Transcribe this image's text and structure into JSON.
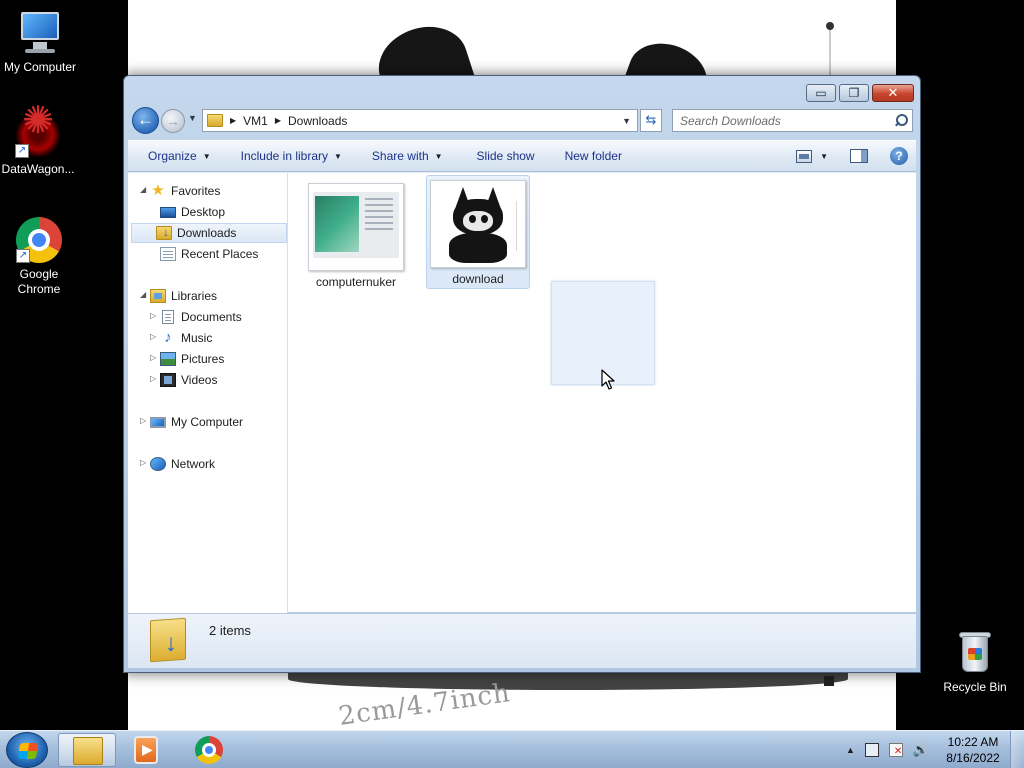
{
  "desktop": {
    "wallpaper_text": "2cm/4.7inch",
    "icons": [
      {
        "label": "My Computer",
        "icon": "computer-icon"
      },
      {
        "label": "DataWagon...",
        "icon": "datawagon-icon"
      },
      {
        "label": "Google Chrome",
        "icon": "chrome-icon"
      },
      {
        "label": "Recycle Bin",
        "icon": "recycle-bin-icon"
      }
    ]
  },
  "window": {
    "controls": {
      "minimize": "▭",
      "maximize": "❐",
      "close": "✕"
    },
    "nav": {
      "back": "←",
      "forward": "→"
    },
    "address": {
      "crumbs": [
        "VM1",
        "Downloads"
      ]
    },
    "search": {
      "placeholder": "Search Downloads"
    },
    "toolbar": {
      "items": [
        {
          "label": "Organize",
          "has_dropdown": true
        },
        {
          "label": "Include in library",
          "has_dropdown": true
        },
        {
          "label": "Share with",
          "has_dropdown": true
        },
        {
          "label": "Slide show",
          "has_dropdown": false
        },
        {
          "label": "New folder",
          "has_dropdown": false
        }
      ],
      "help": "?"
    },
    "nav_pane": {
      "favorites": {
        "label": "Favorites",
        "items": [
          "Desktop",
          "Downloads",
          "Recent Places"
        ],
        "selected": "Downloads"
      },
      "libraries": {
        "label": "Libraries",
        "items": [
          "Documents",
          "Music",
          "Pictures",
          "Videos"
        ]
      },
      "computer": {
        "label": "My Computer"
      },
      "network": {
        "label": "Network"
      }
    },
    "files": [
      {
        "name": "computernuker",
        "type": "screenshot-thumbnail",
        "selected": false
      },
      {
        "name": "download",
        "type": "plush-image-thumbnail",
        "selected": true
      }
    ],
    "details": {
      "item_count": "2 items"
    }
  },
  "taskbar": {
    "apps": [
      {
        "name": "Windows Explorer",
        "icon": "explorer-icon",
        "active": true
      },
      {
        "name": "Windows Media Player",
        "icon": "media-player-icon",
        "active": false
      },
      {
        "name": "Google Chrome",
        "icon": "chrome-icon",
        "active": false
      }
    ],
    "tray": {
      "show_hidden": "▲",
      "volume": "🔊"
    },
    "clock": {
      "time": "10:22 AM",
      "date": "8/16/2022"
    }
  }
}
